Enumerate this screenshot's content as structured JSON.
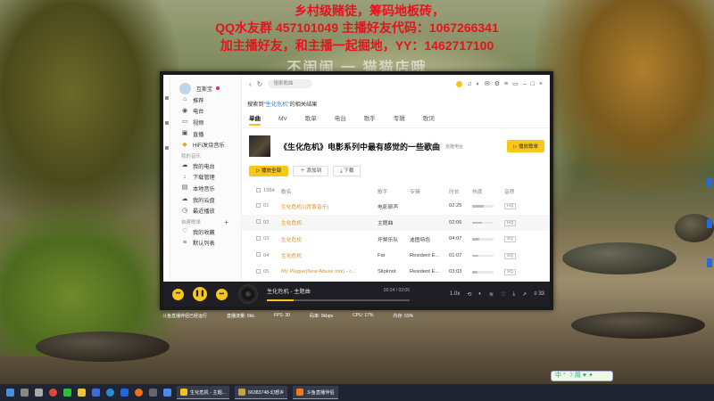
{
  "overlay": {
    "line1": "乡村级赌徒，筹码地板砖，",
    "line2": "QQ水友群 457101049   主播好友代码：1067266341",
    "line3": "加主播好友，和主播一起掘地，YY：1462717100",
    "line4": "不闹闹 一 猫猫店哦"
  },
  "sidebar": {
    "brand": "互斯宝",
    "items_top": [
      {
        "icon": "home-icon",
        "label": "推荐"
      },
      {
        "icon": "radio-icon",
        "label": "电台"
      },
      {
        "icon": "video-icon",
        "label": "视频"
      },
      {
        "icon": "live-icon",
        "label": "直播"
      },
      {
        "icon": "hifi-icon",
        "label": "HiFi发烧音乐"
      }
    ],
    "section_mine": "我的音乐",
    "items_mine": [
      {
        "icon": "cloud-icon",
        "label": "我的电台"
      },
      {
        "icon": "download-icon",
        "label": "下载管理"
      },
      {
        "icon": "local-music-icon",
        "label": "本地音乐"
      },
      {
        "icon": "cloud-disk-icon",
        "label": "我的云盘"
      },
      {
        "icon": "recent-icon",
        "label": "最近播放"
      }
    ],
    "section_playlist": "自建歌单",
    "items_playlist": [
      {
        "icon": "heart-icon",
        "label": "我的收藏"
      },
      {
        "icon": "list-icon",
        "label": "默认列表"
      }
    ]
  },
  "topbar": {
    "search_placeholder": "搜索歌曲"
  },
  "search_hint": {
    "prefix": "搜索到",
    "keyword": "生化危机",
    "suffix": "的相关结果"
  },
  "tabs": [
    "单曲",
    "MV",
    "歌单",
    "电台",
    "歌手",
    "专辑",
    "歌词"
  ],
  "album": {
    "title": "《生化危机》电影系列中最有感觉的一些歌曲",
    "sub": "克隆电台",
    "play_label": "播放歌单"
  },
  "actions": {
    "play_all": "播放全部",
    "add": "添加到",
    "download": "下载"
  },
  "table": {
    "headers": {
      "count": "1984",
      "title": "歌名",
      "singer": "歌手",
      "album": "专辑",
      "duration": "时长",
      "hot": "热度",
      "quality": "音质"
    },
    "rows": [
      {
        "no": "01",
        "title": "生化危机1(背景音乐)",
        "singer": "电影原声",
        "album": "",
        "duration": "02:25",
        "hot": 0.55,
        "quality": "HQ"
      },
      {
        "no": "02",
        "title": "生化危机",
        "singer": "主题曲",
        "album": "",
        "duration": "02:06",
        "hot": 0.45,
        "quality": "HQ"
      },
      {
        "no": "03",
        "title": "生化危机",
        "singer": "坏獒乐队",
        "album": "迪图特色",
        "duration": "04:07",
        "hot": 0.35,
        "quality": "SQ"
      },
      {
        "no": "04",
        "title": "生化危机",
        "singer": "Far",
        "album": "Resident E...",
        "duration": "01:07",
        "hot": 0.3,
        "quality": "SQ"
      },
      {
        "no": "05",
        "title": "My Plague(New Abuse mix) - r...",
        "singer": "Slipknot",
        "album": "Resident E...",
        "duration": "03:03",
        "hot": 0.25,
        "quality": "SQ"
      }
    ]
  },
  "player": {
    "now_playing": "生化危机 - 主题曲",
    "time": "00:24 / 02:06",
    "progress": 0.19,
    "speed": "1.0x",
    "count": "33"
  },
  "status": {
    "left": "斗鱼直播伴侣已经运行",
    "items": [
      "直播流量: 0kb",
      "FPS: 30",
      "码率: 0kbps",
      "CPU: 17%",
      "内存: 59%"
    ]
  },
  "widget": "中 ° ☽ 简 ♥ ✦",
  "taskbar": {
    "tasks": [
      "生化危机 - 主题...",
      "66383748-幻想乡",
      "斗鱼直播伴侣"
    ]
  },
  "colors": {
    "accent": "#f9c61a",
    "overlay_red": "#e8121e",
    "link": "#1a8cff"
  }
}
